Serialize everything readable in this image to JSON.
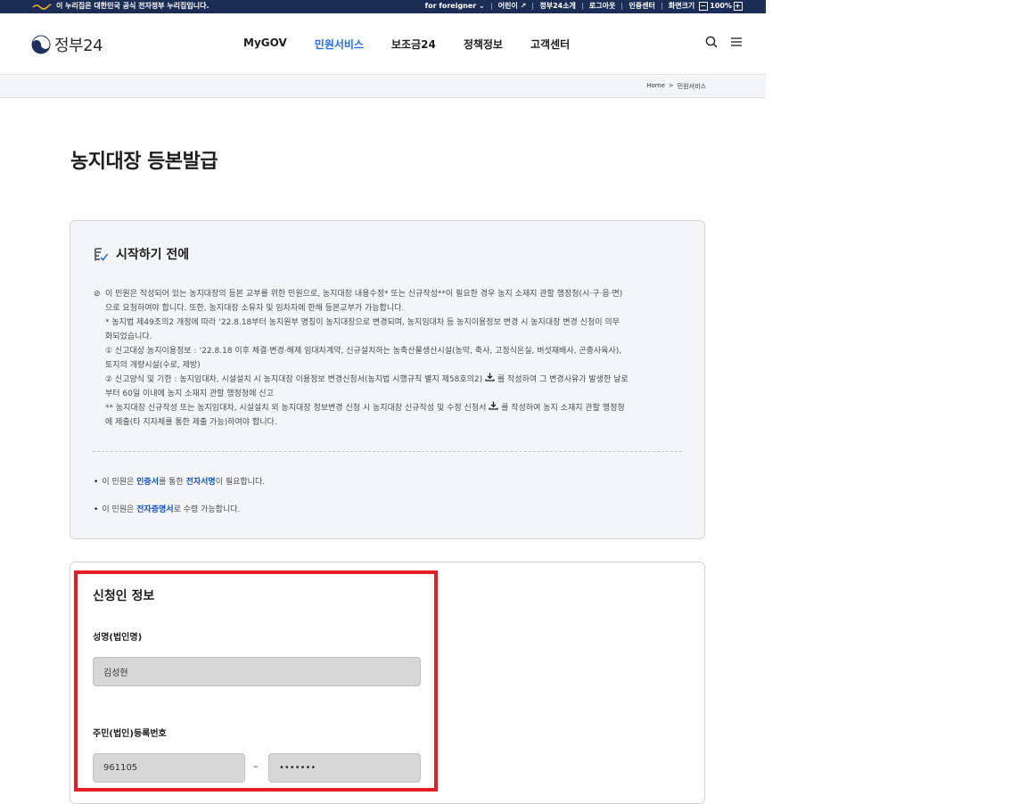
{
  "top_strip": {
    "notice": "이 누리집은 대한민국 공식 전자정부 누리집입니다.",
    "links": [
      "for foreigner",
      "어린이",
      "정부24소개",
      "로그아웃",
      "인증센터",
      "화면크기"
    ],
    "zoom_minus": "−",
    "zoom_value": "100%",
    "zoom_plus": "+"
  },
  "header": {
    "logo_text": "정부24",
    "nav": [
      "MyGOV",
      "민원서비스",
      "보조금24",
      "정책정보",
      "고객센터"
    ],
    "active_nav": "민원서비스"
  },
  "breadcrumb": {
    "home": "Home",
    "sep": ">",
    "current": "민원서비스"
  },
  "page_title": "농지대장 등본발급",
  "info": {
    "heading": "시작하기 전에",
    "check_mark": "⊘",
    "line1": "이 민원은 작성되어 있는 농지대장의 등본 교부를 위한 민원으로, 농지대장 내용수정* 또는 신규작성**이 필요한 경우 농지 소재지 관할 행정청(시·구·읍·면)",
    "line2": "으로 요청하여야 합니다. 또한, 농지대장 소유자 및 임차자에 한해 등본교부가 가능합니다.",
    "line3": "* 농지법 제49조의2 개정에 따라 ‘22.8.18부터 농지원부 명칭이 농지대장으로 변경되며, 농지임대차 등 농지이용정보 변경 시 농지대장 변경 신청이 의무",
    "line4": "화되었습니다.",
    "line5": "① 신고대상 농지이용정보 : ‘22.8.18 이후 체결·변경·해제 임대차계약, 신규설치하는 농축산물생산시설(농막, 축사, 고정식온실, 버섯재배사, 곤충사육사),",
    "line6": "토지의 개량시설(수로, 제방)",
    "line7": "② 신고양식 및 기한 : 농지임대차, 시설설치 시 농지대장 이용정보 변경신청서(농지법 시행규칙 별지 제58호의2)",
    "line7b": "를 작성하여 그 변경사유가 발생한 날로",
    "line8": "부터 60일 이내에 농지 소재지 관할 행정청에 신고",
    "line9": "** 농지대장 신규작성 또는 농지임대차, 시설설치 외 농지대장 정보변경 신청 시 농지대장 신규작성 및 수정 신청서",
    "line9b": "를 작성하여 농지 소재지 관할 행정청",
    "line10": "에 제출(타 지자체를 통한 제출 가능)하여야 합니다.",
    "note1_pre": "이 민원은 ",
    "note1_b1": "인증서",
    "note1_mid": "를 통한 ",
    "note1_b2": "전자서명",
    "note1_post": "이 필요합니다.",
    "note2_pre": "이 민원은 ",
    "note2_b": "전자증명서",
    "note2_post": "로 수령 가능합니다."
  },
  "applicant": {
    "heading": "신청인 정보",
    "name_label": "성명(법인명)",
    "name_value": "김성현",
    "rrn_label": "주민(법인)등록번호",
    "rrn_front": "961105",
    "rrn_dash": "–",
    "rrn_back": "•••••••"
  },
  "colors": {
    "accent": "#256ef4",
    "highlight": "#e41e26",
    "topbar": "#1b2d55",
    "bold_link": "#0b50d0"
  }
}
